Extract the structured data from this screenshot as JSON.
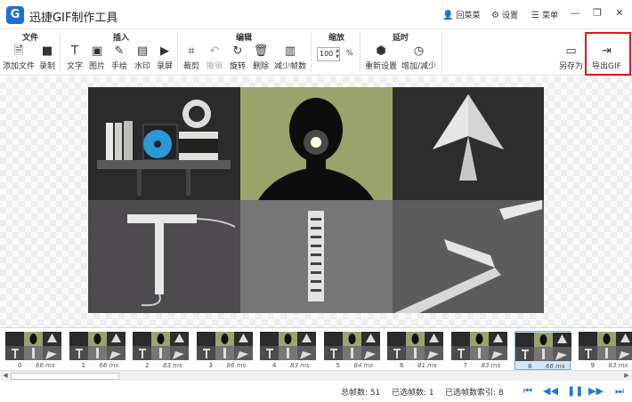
{
  "app": {
    "title": "迅捷GIF制作工具",
    "logo_letter": "G",
    "register_label": "回菜菜",
    "settings_label": "设置",
    "menu_label": "菜单"
  },
  "toolbar": {
    "groups": {
      "file": "文件",
      "insert": "插入",
      "edit": "编辑",
      "zoom": "缩放",
      "delay": "延时"
    },
    "tools": {
      "add_file": "添加文件",
      "record": "录制",
      "text": "文字",
      "image": "图片",
      "handdraw": "手绘",
      "watermark": "水印",
      "screen_record": "录屏",
      "crop": "裁剪",
      "undo": "撤销",
      "rotate": "旋转",
      "delete": "删除",
      "reduce_frames": "减少帧数",
      "reset": "重新设置",
      "add_reduce": "增加/减少",
      "save_as": "另存为",
      "export_gif": "导出GIF"
    },
    "zoom_value": "100",
    "zoom_unit": "%"
  },
  "filmstrip": [
    {
      "index": "0",
      "delay": "66 ms"
    },
    {
      "index": "1",
      "delay": "66 ms"
    },
    {
      "index": "2",
      "delay": "83 ms"
    },
    {
      "index": "3",
      "delay": "86 ms"
    },
    {
      "index": "4",
      "delay": "83 ms"
    },
    {
      "index": "5",
      "delay": "84 ms"
    },
    {
      "index": "6",
      "delay": "81 ms"
    },
    {
      "index": "7",
      "delay": "83 ms"
    },
    {
      "index": "8",
      "delay": "66 ms"
    },
    {
      "index": "9",
      "delay": "83 ms"
    }
  ],
  "selected_frame": "8",
  "status": {
    "total": "总帧数: 51",
    "selected": "已选帧数: 1",
    "selected_index": "已选帧数索引: 8"
  },
  "colors": {
    "accent": "#1e78d8",
    "highlight": "#e0141e",
    "olive": "#9aa36a"
  }
}
